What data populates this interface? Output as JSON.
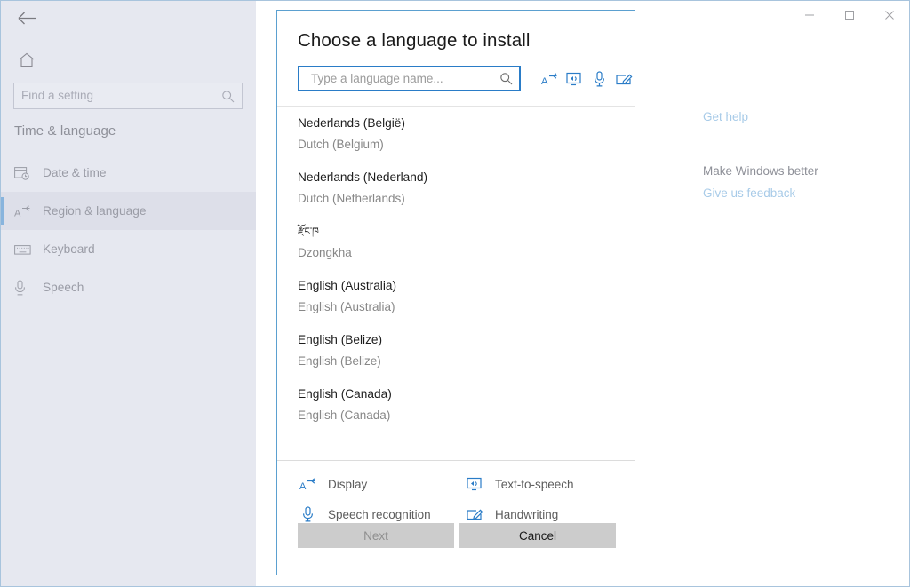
{
  "window": {
    "controls": [
      {
        "name": "minimize",
        "glyph": "minimize-icon"
      },
      {
        "name": "maximize",
        "glyph": "maximize-icon"
      },
      {
        "name": "close",
        "glyph": "close-icon"
      }
    ]
  },
  "sidebar": {
    "back_label": "back-arrow",
    "home_label": "home-icon",
    "search": {
      "placeholder": "Find a setting",
      "value": ""
    },
    "section_title": "Time & language",
    "items": [
      {
        "label": "Date & time",
        "icon": "calendar-clock-icon",
        "selected": false
      },
      {
        "label": "Region & language",
        "icon": "language-icon",
        "selected": true
      },
      {
        "label": "Keyboard",
        "icon": "keyboard-icon",
        "selected": false
      },
      {
        "label": "Speech",
        "icon": "microphone-icon",
        "selected": false
      }
    ]
  },
  "content": {
    "get_help": "Get help",
    "make_windows_better": "Make Windows better",
    "give_us_feedback": "Give us feedback"
  },
  "dialog": {
    "title": "Choose a language to install",
    "search": {
      "placeholder": "Type a language name...",
      "value": ""
    },
    "capability_icons": [
      {
        "name": "display-icon"
      },
      {
        "name": "text-to-speech-icon"
      },
      {
        "name": "speech-recognition-icon"
      },
      {
        "name": "handwriting-icon"
      }
    ],
    "languages": [
      {
        "native": "Nederlands (België)",
        "english": "Dutch (Belgium)",
        "markers": [
          true,
          false,
          true
        ]
      },
      {
        "native": "Nederlands (Nederland)",
        "english": "Dutch (Netherlands)",
        "markers": [
          true,
          false,
          true
        ]
      },
      {
        "native": "རྫོང་ཁ",
        "english": "Dzongkha",
        "markers": [
          false,
          false,
          false
        ],
        "tibetan": true
      },
      {
        "native": "English (Australia)",
        "english": "English (Australia)",
        "markers": [
          true,
          true,
          true
        ]
      },
      {
        "native": "English (Belize)",
        "english": "English (Belize)",
        "markers": [
          false,
          false,
          true
        ]
      },
      {
        "native": "English (Canada)",
        "english": "English (Canada)",
        "markers": [
          true,
          true,
          true
        ]
      }
    ],
    "legend": [
      {
        "label": "Display",
        "icon": "display-icon"
      },
      {
        "label": "Text-to-speech",
        "icon": "text-to-speech-icon"
      },
      {
        "label": "Speech recognition",
        "icon": "speech-recognition-icon"
      },
      {
        "label": "Handwriting",
        "icon": "handwriting-icon"
      }
    ],
    "buttons": {
      "next": "Next",
      "cancel": "Cancel",
      "next_disabled": true
    }
  },
  "colors": {
    "accent": "#2a7cc7",
    "dialog_border": "#5ba0d0",
    "sidebar_bg": "#e6e8f0",
    "marker": "#6f6f6f",
    "button_bg": "#cccccc"
  }
}
